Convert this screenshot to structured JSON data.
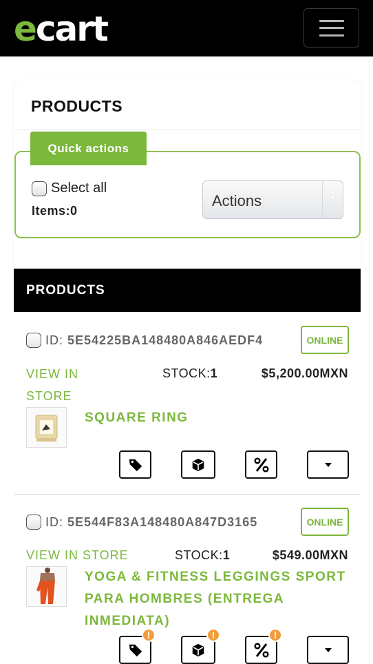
{
  "header": {
    "logo_e": "e",
    "logo_rest": "cart",
    "logo_color": "#7cb83b",
    "menu_icon": "hamburger-icon"
  },
  "page": {
    "title": "PRODUCTS"
  },
  "quick_actions": {
    "tab_label": "Quick actions",
    "select_all_label": "Select all",
    "items_label": "Items:",
    "items_count": "0",
    "actions_select_value": "Actions"
  },
  "products_section": {
    "title": "PRODUCTS",
    "items": [
      {
        "id_label": "ID:",
        "id_value": "5E54225BA148480A846AEDF4",
        "status": "ONLINE",
        "view_label": "VIEW IN STORE",
        "stock_label": "STOCK:",
        "stock_value": "1",
        "price": "$5,200.00MXN",
        "name": "SQUARE RING",
        "icons": [
          "tag-icon",
          "box-icon",
          "percent-icon",
          "caret-down-icon"
        ],
        "warnings": false
      },
      {
        "id_label": "ID:",
        "id_value": "5E544F83A148480A847D3165",
        "status": "ONLINE",
        "view_label": "VIEW IN STORE",
        "stock_label": "STOCK:",
        "stock_value": "1",
        "price": "$549.00MXN",
        "name": "YOGA & FITNESS LEGGINGS SPORT PARA HOMBRES (ENTREGA INMEDIATA)",
        "icons": [
          "tag-icon",
          "box-icon",
          "percent-icon",
          "caret-down-icon"
        ],
        "warnings": true,
        "warning_symbol": "!"
      }
    ]
  },
  "colors": {
    "accent": "#7cb83b",
    "warning": "#f39c3c",
    "header_bg": "#000000"
  }
}
